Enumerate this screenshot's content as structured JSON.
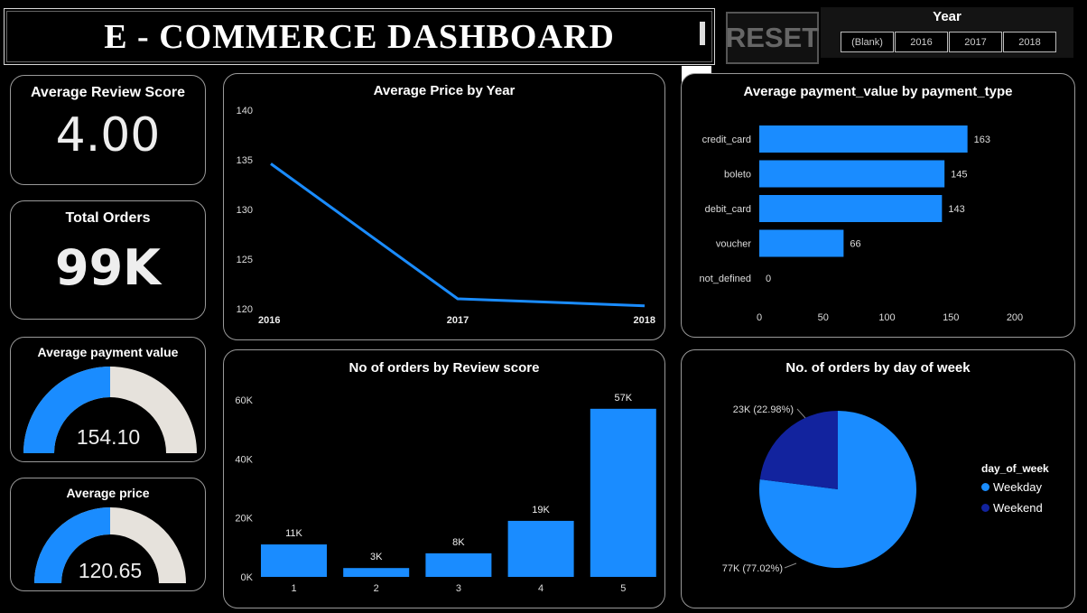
{
  "header": {
    "title": "E - COMMERCE DASHBOARD"
  },
  "reset": {
    "label": "RESET"
  },
  "slicer": {
    "title": "Year",
    "options": [
      "(Blank)",
      "2016",
      "2017",
      "2018"
    ]
  },
  "kpis": {
    "review": {
      "label": "Average Review Score",
      "value": "4.00"
    },
    "orders": {
      "label": "Total Orders",
      "value": "99K"
    },
    "payment": {
      "label": "Average payment value",
      "value": "154.10",
      "fill": 0.5
    },
    "price": {
      "label": "Average price",
      "value": "120.65",
      "fill": 0.5
    }
  },
  "colors": {
    "accent": "#1a8cff",
    "dark_blue": "#12239e",
    "gauge_bg": "#e6e2dc"
  },
  "chart_data": [
    {
      "id": "price_by_year",
      "type": "line",
      "title": "Average Price by Year",
      "x": [
        "2016",
        "2017",
        "2018"
      ],
      "values": [
        134.6,
        121.0,
        120.3
      ],
      "ylim": [
        120,
        140
      ],
      "yticks": [
        "140",
        "135",
        "130",
        "125",
        "120"
      ]
    },
    {
      "id": "payment_by_type",
      "type": "bar",
      "orientation": "horizontal",
      "title": "Average payment_value by payment_type",
      "categories": [
        "credit_card",
        "boleto",
        "debit_card",
        "voucher",
        "not_defined"
      ],
      "values": [
        163,
        145,
        143,
        66,
        0
      ],
      "labels": [
        "163",
        "145",
        "143",
        "66",
        "0"
      ],
      "xlim": [
        0,
        200
      ],
      "xticks": [
        "0",
        "50",
        "100",
        "150",
        "200"
      ]
    },
    {
      "id": "orders_by_review",
      "type": "bar",
      "title": "No of orders by Review score",
      "categories": [
        "1",
        "2",
        "3",
        "4",
        "5"
      ],
      "values": [
        11,
        3,
        8,
        19,
        57
      ],
      "labels": [
        "11K",
        "3K",
        "8K",
        "19K",
        "57K"
      ],
      "ylim": [
        0,
        60
      ],
      "yticks": [
        "60K",
        "40K",
        "20K",
        "0K"
      ]
    },
    {
      "id": "orders_by_day",
      "type": "pie",
      "title": "No. of orders by day of week",
      "legend_title": "day_of_week",
      "series": [
        {
          "name": "Weekday",
          "value": 77.02,
          "label": "77K (77.02%)",
          "color": "#1a8cff"
        },
        {
          "name": "Weekend",
          "value": 22.98,
          "label": "23K (22.98%)",
          "color": "#12239e"
        }
      ]
    }
  ]
}
